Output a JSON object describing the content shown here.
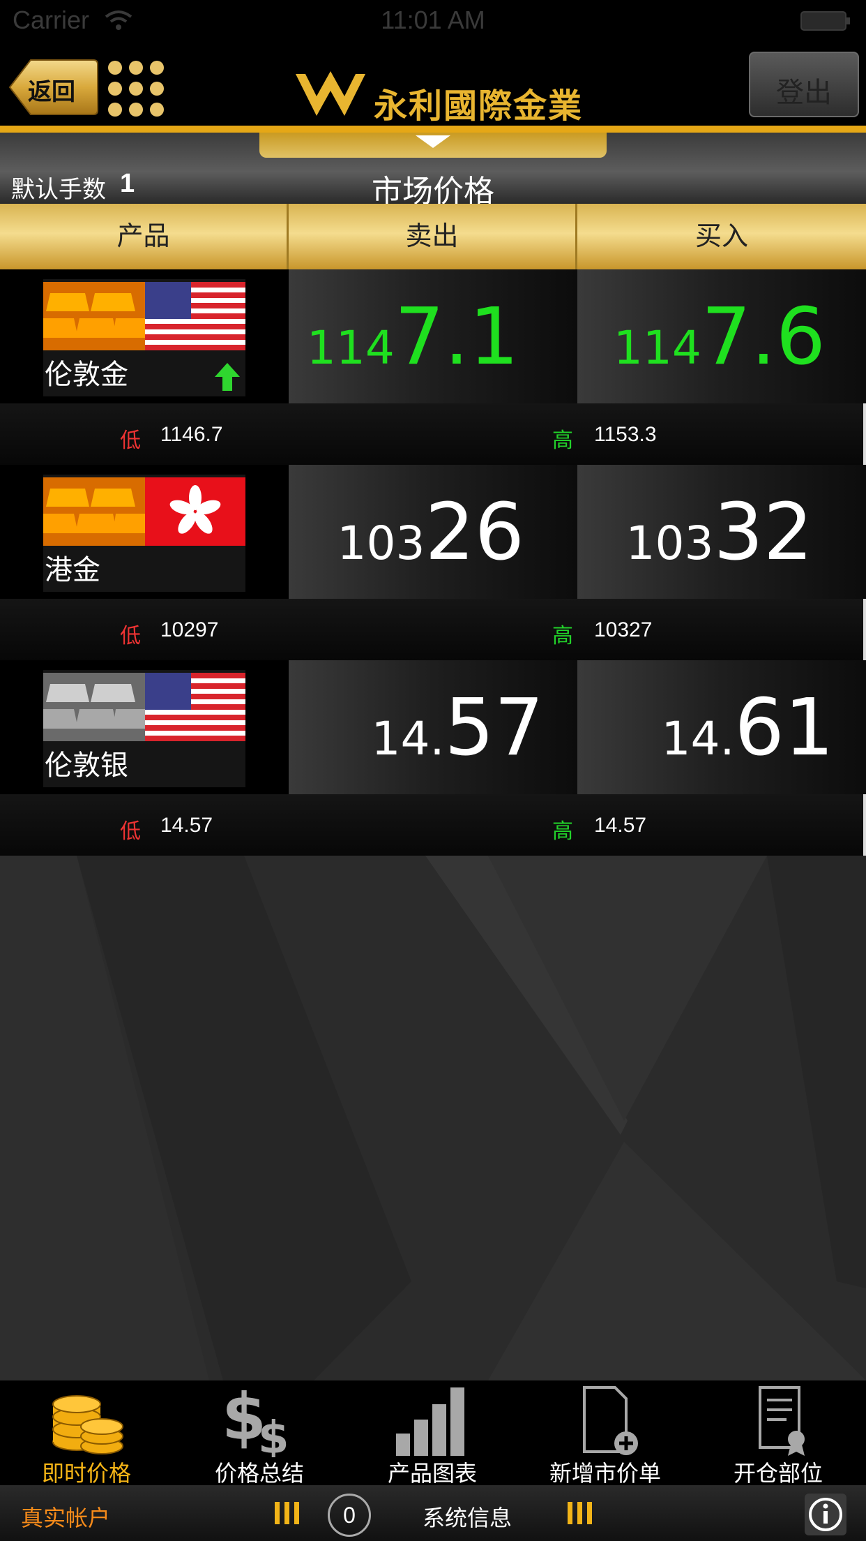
{
  "status_bar": {
    "carrier": "Carrier",
    "time": "11:01 AM"
  },
  "header": {
    "back_label": "返回",
    "logo_text": "永利國際金業",
    "logout_label": "登出"
  },
  "title_band": {
    "default_lots_label": "默认手数",
    "default_lots_value": "1",
    "page_title": "市场价格"
  },
  "columns": {
    "product": "产品",
    "sell": "卖出",
    "buy": "买入"
  },
  "products": [
    {
      "name": "伦敦金",
      "sell_small": "114",
      "sell_big": "7.1",
      "buy_small": "114",
      "buy_big": "7.6",
      "low_label": "低",
      "low": "1146.7",
      "high_label": "高",
      "high": "1153.3",
      "price_color": "#1fe01f"
    },
    {
      "name": "港金",
      "sell_small": "103",
      "sell_big": "26",
      "buy_small": "103",
      "buy_big": "32",
      "low_label": "低",
      "low": "10297",
      "high_label": "高",
      "high": "10327",
      "price_color": "#ffffff"
    },
    {
      "name": "伦敦银",
      "sell_small": "14.",
      "sell_big": "57",
      "buy_small": "14.",
      "buy_big": "61",
      "low_label": "低",
      "low": "14.57",
      "high_label": "高",
      "high": "14.57",
      "price_color": "#ffffff"
    }
  ],
  "tabs": [
    {
      "label": "即时价格",
      "icon": "coins-icon",
      "active": true
    },
    {
      "label": "价格总结",
      "icon": "dollar-signs-icon",
      "active": false
    },
    {
      "label": "产品图表",
      "icon": "bar-chart-icon",
      "active": false
    },
    {
      "label": "新增市价单",
      "icon": "new-document-icon",
      "active": false
    },
    {
      "label": "开仓部位",
      "icon": "certificate-icon",
      "active": false
    }
  ],
  "footer": {
    "account_label": "真实帐户",
    "message_count": "0",
    "system_info_label": "系统信息"
  },
  "colors": {
    "accent_gold": "#e5a716",
    "up_green": "#1fe01f",
    "low_red": "#ee3333",
    "high_green": "#22d22a",
    "account_orange": "#f58a1a"
  }
}
